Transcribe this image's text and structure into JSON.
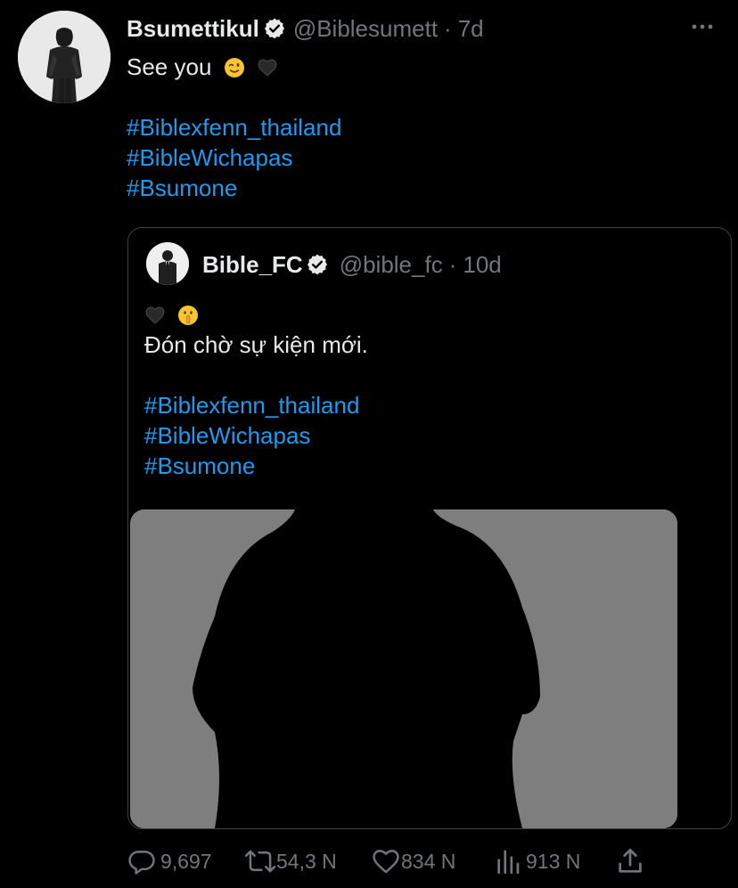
{
  "tweet": {
    "author": {
      "display_name": "Bsumettikul",
      "handle": "@Biblesumett",
      "time": "7d",
      "dot": "·",
      "avatar": "profile-photo"
    },
    "text": {
      "line1": "See you",
      "emoji1": "winking-face",
      "emoji2": "black-heart",
      "hashtags": [
        "#Biblexfenn_thailand",
        "#BibleWichapas",
        "#Bsumone"
      ]
    },
    "more_icon": "more-horizontal-icon"
  },
  "quoted": {
    "author": {
      "display_name": "Bible_FC",
      "handle": "@bible_fc",
      "time": "10d",
      "dot": "·",
      "avatar": "profile-photo"
    },
    "text": {
      "emoji_line": [
        "black-heart",
        "shushing-face"
      ],
      "line1": "Đón chờ sự kiện mới.",
      "hashtags": [
        "#Biblexfenn_thailand",
        "#BibleWichapas",
        "#Bsumone"
      ]
    },
    "media": "silhouette-photo"
  },
  "actions": {
    "reply_count": "9,697",
    "retweet_count": "54,3 N",
    "like_count": "834 N",
    "views_count": "913 N",
    "icons": [
      "reply-icon",
      "retweet-icon",
      "like-icon",
      "views-icon",
      "share-icon"
    ]
  },
  "colors": {
    "background": "#000000",
    "text": "#e7e9ea",
    "secondary": "#71767b",
    "link": "#1d9bf0",
    "border": "#3e4144"
  }
}
